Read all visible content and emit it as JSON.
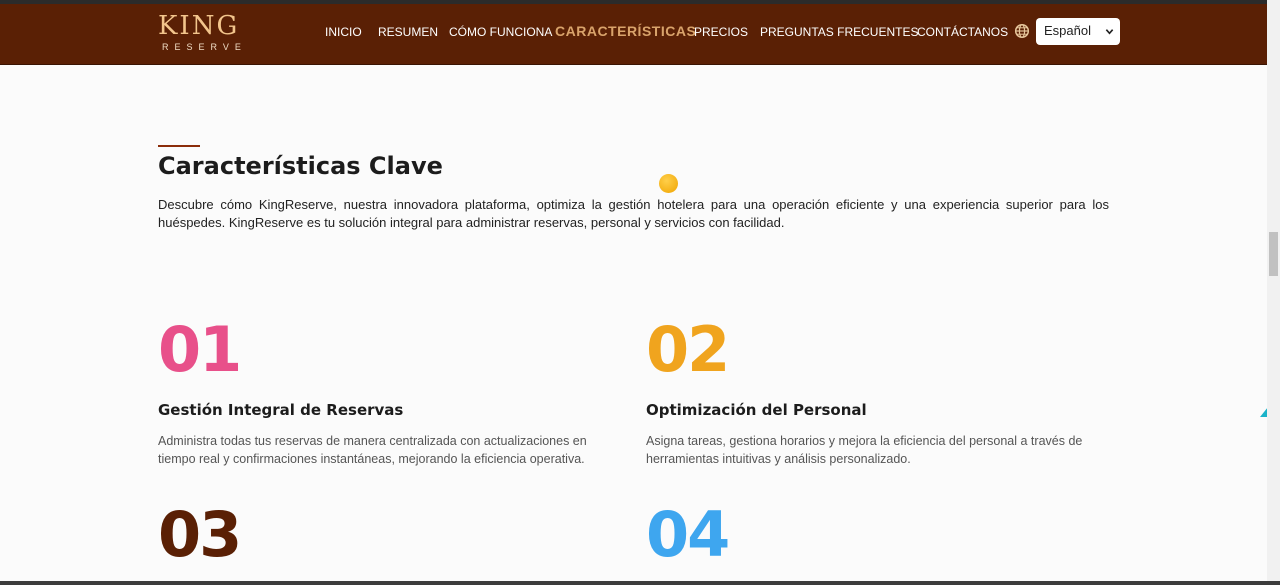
{
  "brand": {
    "logo_main": "KING",
    "logo_sub": "RESERVE"
  },
  "nav": {
    "items": [
      {
        "label": "INICIO"
      },
      {
        "label": "RESUMEN"
      },
      {
        "label": "CÓMO FUNCIONA"
      },
      {
        "label": "CARACTERÍSTICAS"
      },
      {
        "label": "PRECIOS"
      },
      {
        "label": "PREGUNTAS FRECUENTES"
      },
      {
        "label": "CONTÁCTANOS"
      }
    ],
    "language": {
      "icon": "globe-icon",
      "selected": "Español"
    }
  },
  "section": {
    "title": "Características Clave",
    "intro": "Descubre cómo KingReserve, nuestra innovadora plataforma, optimiza la gestión hotelera para una operación eficiente y una experiencia superior para los huéspedes. KingReserve es tu solución integral para administrar reservas, personal y servicios con facilidad."
  },
  "features": [
    {
      "number": "01",
      "title": "Gestión Integral de Reservas",
      "description": "Administra todas tus reservas de manera centralizada con actualizaciones en tiempo real y confirmaciones instantáneas, mejorando la eficiencia operativa.",
      "color": "#e8508a"
    },
    {
      "number": "02",
      "title": "Optimización del Personal",
      "description": "Asigna tareas, gestiona horarios y mejora la eficiencia del personal a través de herramientas intuitivas y análisis personalizado.",
      "color": "#f0a41e"
    },
    {
      "number": "03",
      "color": "#5a2005"
    },
    {
      "number": "04",
      "color": "#3ea6ef"
    }
  ],
  "colors": {
    "nav_bg": "#5a2005",
    "nav_active": "#d9a36b",
    "logo": "#f2c58c",
    "accent_rule": "#8b2d0a"
  }
}
